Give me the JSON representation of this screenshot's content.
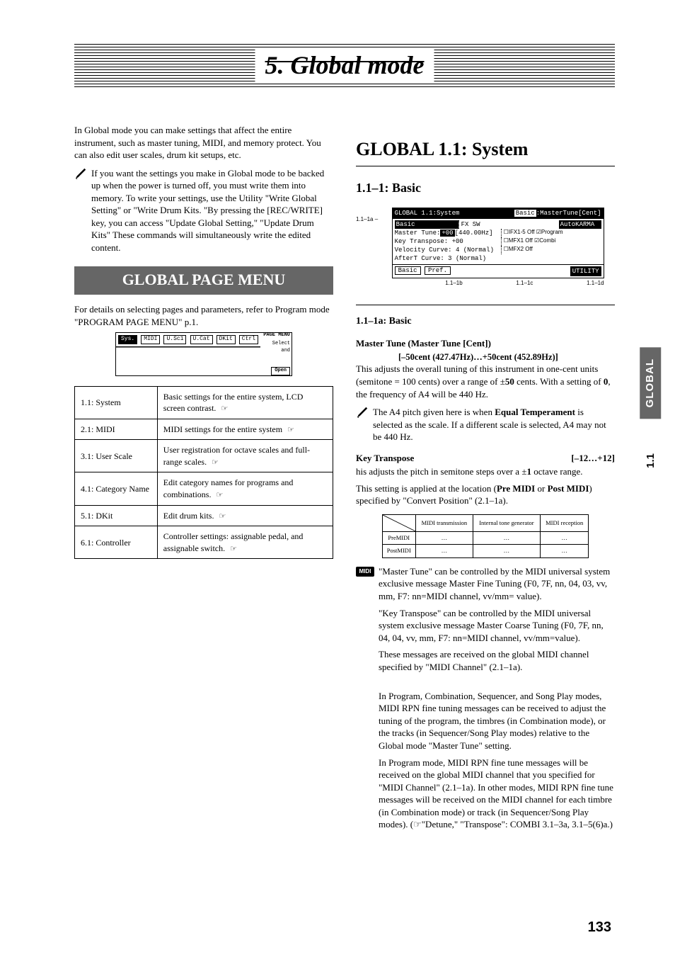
{
  "chapter_title": "5. Global mode",
  "intro_p1": "In Global mode you can make settings that affect the entire instrument, such as master tuning, MIDI, and memory protect. You can also edit user scales, drum kit setups, etc.",
  "intro_note": "If you want the settings you make in Global mode to be backed up when the power is turned off, you must write them into memory. To write your settings, use the Utility \"Write Global Setting\" or \"Write Drum Kits. \"By pressing the [REC/WRITE] key, you can access \"Update Global Setting,\" \"Update Drum Kits\" These commands will simultaneously write the edited content.",
  "menu_heading": "GLOBAL PAGE MENU",
  "menu_p": "For details on selecting pages and parameters, refer to Program mode \"PROGRAM PAGE MENU\" p.1.",
  "lcd2": {
    "tabs": [
      "Sys.",
      "MIDI",
      "U.Sc1",
      "U.Cat",
      "DKit",
      "Ctrl"
    ],
    "labels": [
      "PAGE MENU",
      "Select and",
      "Open"
    ]
  },
  "index_rows": [
    {
      "l": "1.1: System",
      "r": "Basic settings for the entire system, LCD screen contrast."
    },
    {
      "l": "2.1: MIDI",
      "r": "MIDI settings for the entire system"
    },
    {
      "l": "3.1: User Scale",
      "r": "User registration for octave scales and full-range scales."
    },
    {
      "l": "4.1: Category Name",
      "r": "Edit category names for programs and combinations."
    },
    {
      "l": "5.1: DKit",
      "r": "Edit drum kits."
    },
    {
      "l": "6.1: Controller",
      "r": "Controller settings: assignable pedal, and assignable switch."
    }
  ],
  "ptr": "☞",
  "sys_heading": "GLOBAL 1.1: System",
  "basic_heading": "1.1–1: Basic",
  "lcd": {
    "topL": "GLOBAL 1.1:System",
    "topR": "Basic:MasterTune[Cent]",
    "r0L": "Basic",
    "r0M": "FX SW",
    "r0R": "AutoKARMA",
    "r1": "Master Tune:+00 [440.00Hz]",
    "r1b": "☐IFX1-5 Off ☑Program",
    "r2": "Key Transpose: +00",
    "r2b": "☐MFX1 Off  ☑Combi",
    "r3": "Velocity Curve: 4 (Normal)",
    "r3b": "☐MFX2 Off",
    "r4": "AfterT Curve:  3 (Normal)",
    "tabs": [
      "Basic",
      "Pref."
    ],
    "utility": "UTILITY"
  },
  "hdr_labels": [
    "1.1–1a",
    "1.1–1b",
    "1.1–1c",
    "1.1–1d"
  ],
  "sec_1a": "1.1–1a: Basic",
  "mt_label": "Master Tune (Master Tune [Cent])",
  "mt_range": "[–50cent (427.47Hz)…+50cent (452.89Hz)]",
  "mt_p": "This adjusts the overall tuning of this instrument in one-cent units (semitone = 100 cents) over a range of ±50 cents. With a setting of 0, the frequency of A4 will be 440 Hz.",
  "mt_note": "The A4 pitch given here is when Equal Temperament is selected as the scale. If a different scale is selected, A4 may not be 440 Hz.",
  "kt_label": "Key Transpose",
  "kt_range": "[–12…+12]",
  "kt_p1": "his adjusts the pitch in semitone steps over a ±1 octave range.",
  "kt_p2": "This setting is applied at the location (Pre MIDI or Post MIDI) specified by \"Convert Position\" (2.1–1a).",
  "conv": {
    "cols": [
      "",
      "MIDI transmission",
      "Internal tone generator",
      "MIDI reception"
    ],
    "rows": [
      [
        "PreMIDI",
        "…",
        "…",
        "…"
      ],
      [
        "PostMIDI",
        "…",
        "…",
        "…"
      ]
    ]
  },
  "midi_note1": "\"Master Tune\" can be controlled by the MIDI universal system exclusive message Master Fine Tuning (F0, 7F, nn, 04, 03, vv, mm, F7: nn=MIDI channel, vv/mm= value).",
  "midi_note2": "\"Key Transpose\" can be controlled by the MIDI universal system exclusive message Master Coarse Tuning (F0, 7F, nn, 04, 04, vv, mm, F7: nn=MIDI channel, vv/mm=value).",
  "midi_note3": "These messages are received on the global MIDI channel specified by \"MIDI Channel\" (2.1–1a).",
  "midi_note4": "In Program, Combination, Sequencer, and Song Play modes, MIDI RPN fine tuning messages can be received to adjust the tuning of the program, the timbres (in Combination mode), or the tracks (in Sequencer/Song Play modes) relative to the Global mode \"Master Tune\" setting.",
  "midi_note5": "In Program mode, MIDI RPN fine tune messages will be received on the global MIDI channel that you specified for \"MIDI Channel\" (2.1–1a). In other modes, MIDI RPN fine tune messages will be received on the MIDI channel for each timbre (in Combination mode) or track (in Sequencer/Song Play modes). (☞\"Detune,\" \"Transpose\": COMBI 3.1–3a, 3.1–5(6)a.)",
  "side_tab": "GLOBAL",
  "side_num": "1.1",
  "pagenum": "133"
}
